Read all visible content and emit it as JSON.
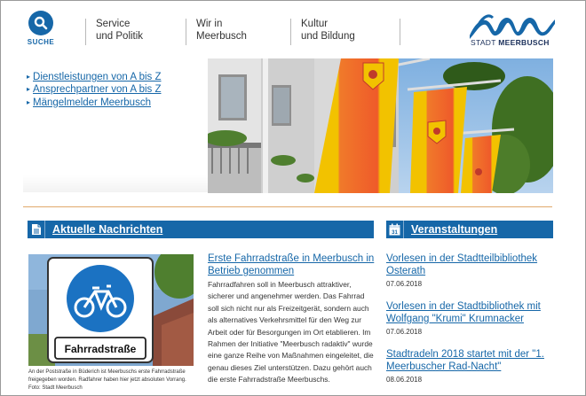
{
  "header": {
    "search_label": "SUCHE",
    "nav": [
      {
        "line1": "Service",
        "line2": "und Politik"
      },
      {
        "line1": "Wir in",
        "line2": "Meerbusch"
      },
      {
        "line1": "Kultur",
        "line2": "und Bildung"
      }
    ],
    "logo_prefix": "STADT",
    "logo_name": "MEERBUSCH"
  },
  "quicklinks": [
    {
      "arrow": "▸",
      "label": "Dienstleistungen von A bis Z"
    },
    {
      "arrow": "▸",
      "label": "Ansprechpartner von A bis Z"
    },
    {
      "arrow": "▸",
      "label": "Mängelmelder Meerbusch"
    }
  ],
  "news": {
    "section_title": "Aktuelle Nachrichten",
    "sign_text": "Fahrradstraße",
    "caption": "An der Poststraße in Büderich ist Meerbuschs erste Fahrradstraße freigegeben worden. Radfahrer haben hier jetzt absoluten Vorrang. Foto: Stadt Meerbusch",
    "title": "Erste Fahrradstraße in Meerbusch in Betrieb genommen",
    "body": "Fahrradfahren soll in Meerbusch attraktiver, sicherer und angenehmer werden. Das Fahrrad soll sich nicht nur als Freizeitgerät, sondern auch als alternatives Verkehrsmittel für den Weg zur Arbeit oder für Besorgungen im Ort etablieren. Im Rahmen der Initiative \"Meerbusch radaktiv\" wurde eine ganze Reihe von Maßnahmen eingeleitet, die genau dieses Ziel unterstützen.  Dazu gehört auch die erste Fahrradstraße Meerbuschs."
  },
  "events": {
    "section_title": "Veranstaltungen",
    "calendar_day": "31",
    "items": [
      {
        "title": "Vorlesen in der Stadtteilbibliothek Osterath",
        "date": "07.06.2018"
      },
      {
        "title": "Vorlesen in der Stadtbibliothek mit Wolfgang \"Krumi\" Krumnacker",
        "date": "07.06.2018"
      },
      {
        "title": "Stadtradeln 2018 startet mit der \"1. Meerbuscher Rad-Nacht\"",
        "date": "08.06.2018"
      }
    ]
  },
  "colors": {
    "brand_blue": "#1667a8",
    "flag_orange": "#f07a2a",
    "flag_yellow": "#f2c200",
    "divider": "#e0a96b"
  }
}
